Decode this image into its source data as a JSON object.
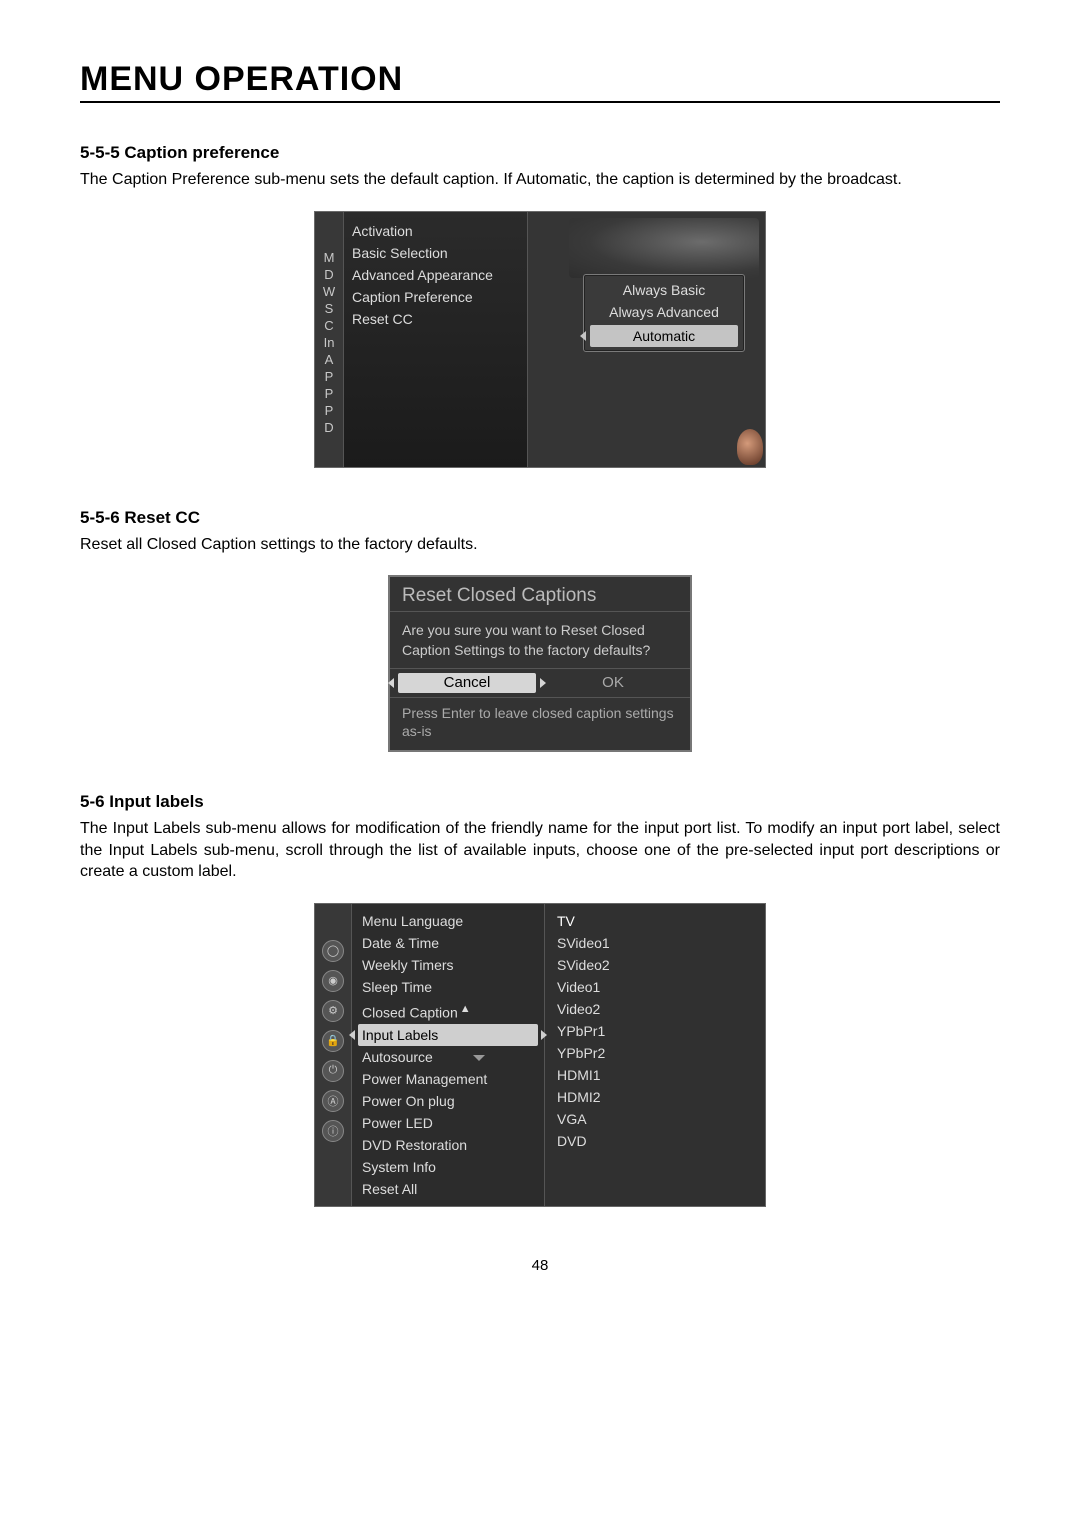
{
  "page": {
    "title": "MENU OPERATION",
    "number": "48"
  },
  "sections": {
    "s1": {
      "heading": "5-5-5  Caption preference",
      "text": "The Caption Preference sub-menu sets the default caption. If Automatic, the caption is determined by the broadcast."
    },
    "s2": {
      "heading": "5-5-6  Reset CC",
      "text": "Reset all Closed Caption settings to the factory defaults."
    },
    "s3": {
      "heading": "5-6  Input labels",
      "text": "The Input Labels sub-menu allows for modification of the friendly name for the input port list. To modify an input port label, select the Input Labels sub-menu, scroll through the list of available inputs, choose one of the pre-selected input port descriptions or create a custom label."
    }
  },
  "fig1": {
    "sidebar": [
      "M",
      "D",
      "W",
      "S",
      "C",
      "In",
      "A",
      "P",
      "P",
      "P",
      "D"
    ],
    "menu": [
      "Activation",
      "Basic Selection",
      "Advanced Appearance",
      "Caption Preference",
      "Reset CC"
    ],
    "options": {
      "opt1": "Always Basic",
      "opt2": "Always Advanced",
      "opt3": "Automatic",
      "selected": "opt3"
    }
  },
  "fig2": {
    "title": "Reset Closed Captions",
    "message": "Are you sure you want to Reset Closed Caption Settings to the factory defaults?",
    "cancel": "Cancel",
    "ok": "OK",
    "hint": "Press Enter to leave closed caption settings as-is"
  },
  "fig3": {
    "menu": [
      "Menu Language",
      "Date & Time",
      "Weekly Timers",
      "Sleep Time",
      "Closed Caption",
      "Input Labels",
      "Autosource",
      "Power Management",
      "Power On plug",
      "Power LED",
      "DVD Restoration",
      "System Info",
      "Reset All"
    ],
    "selected_index": 5,
    "values": [
      "TV",
      "SVideo1",
      "SVideo2",
      "Video1",
      "Video2",
      "YPbPr1",
      "YPbPr2",
      "HDMI1",
      "HDMI2",
      "VGA",
      "DVD"
    ]
  }
}
